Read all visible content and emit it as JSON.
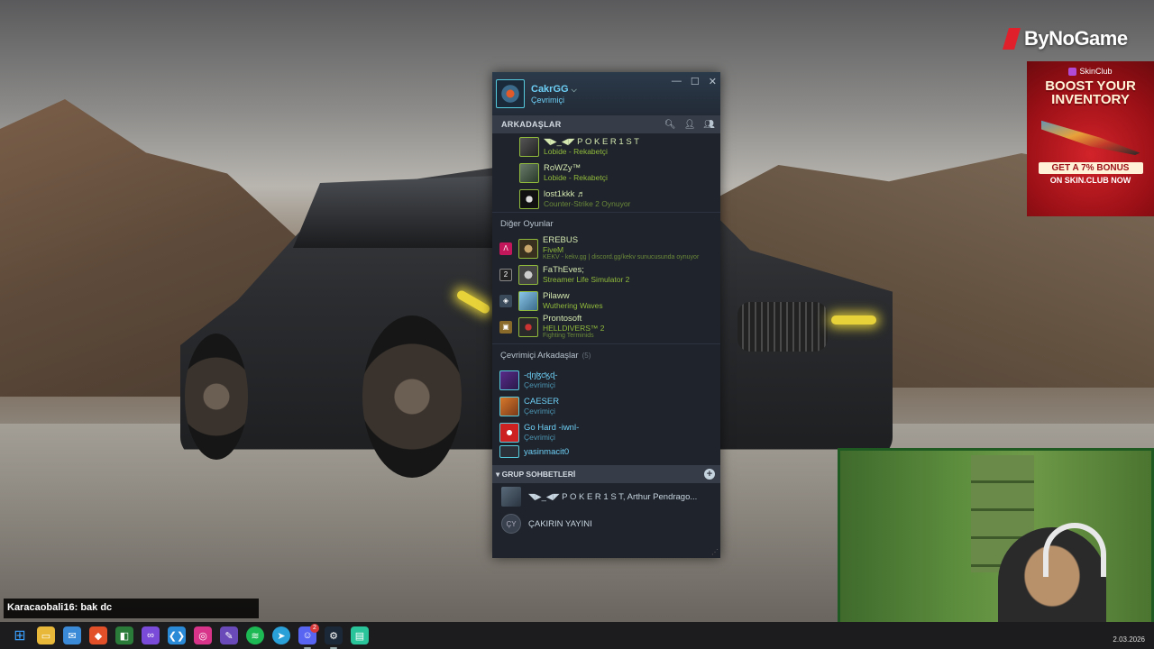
{
  "brand": {
    "name": "ByNoGame"
  },
  "ad": {
    "brand": "SkinClub",
    "title_line1": "BOOST YOUR",
    "title_line2": "INVENTORY",
    "cta_line1": "GET A 7% BONUS",
    "cta_line2": "ON SKIN.CLUB NOW"
  },
  "steam": {
    "username": "CakrGG",
    "status": "Çevrimiçi",
    "friends_header": "ARKADAŞLAR",
    "ingame_group": [
      {
        "name": "◥▶︎_◀◤ P O K E R 1 S T",
        "sub": "Lobide - Rekabetçi"
      },
      {
        "name": "RoWZy™",
        "sub": "Lobide - Rekabetçi"
      },
      {
        "name": "lost1kkk ♬",
        "sub": "Counter-Strike 2 Oynuyor"
      }
    ],
    "other_games_header": "Diğer Oyunlar",
    "other_games": [
      {
        "icon": "Λ",
        "icon_color": "#c2185b",
        "name": "EREBUS",
        "sub": "FiveM",
        "sub2": "KEKV - kekv.gg | discord.gg/kekv sunucusunda oynuyor"
      },
      {
        "icon": "2",
        "icon_color": "#222222",
        "name": "FaThEves;",
        "sub": "Streamer Life Simulator 2",
        "sub2": ""
      },
      {
        "icon": "◈",
        "icon_color": "#3a4a5a",
        "name": "Pilaww",
        "sub": "Wuthering Waves",
        "sub2": ""
      },
      {
        "icon": "▣",
        "icon_color": "#8a6a2a",
        "name": "Prontosoft",
        "sub": "HELLDIVERS™ 2",
        "sub2": "Fighting Terminids"
      }
    ],
    "online_header": "Çevrimiçi Arkadaşlar",
    "online_count": "(5)",
    "online_friends": [
      {
        "name": "-ɖŋɮƈӄɖ-",
        "sub": "Çevrimiçi"
      },
      {
        "name": "CAESER",
        "sub": "Çevrimiçi"
      },
      {
        "name": "Go Hard -iwnl-",
        "sub": "Çevrimiçi"
      },
      {
        "name": "yasinmacit0",
        "sub": ""
      }
    ],
    "group_chats_header": "GRUP SOHBETLERİ",
    "group_chats": [
      {
        "initials": "",
        "name": "◥▶︎_◀◤ P O K E R 1 S T, Arthur Pendrago..."
      },
      {
        "initials": "ÇY",
        "name": "ÇAKIRIN YAYINI"
      }
    ]
  },
  "chat": {
    "message": "Karacaobali16: bak dc"
  },
  "taskbar": {
    "discord_badge": "2",
    "date": "2.03.2026"
  }
}
